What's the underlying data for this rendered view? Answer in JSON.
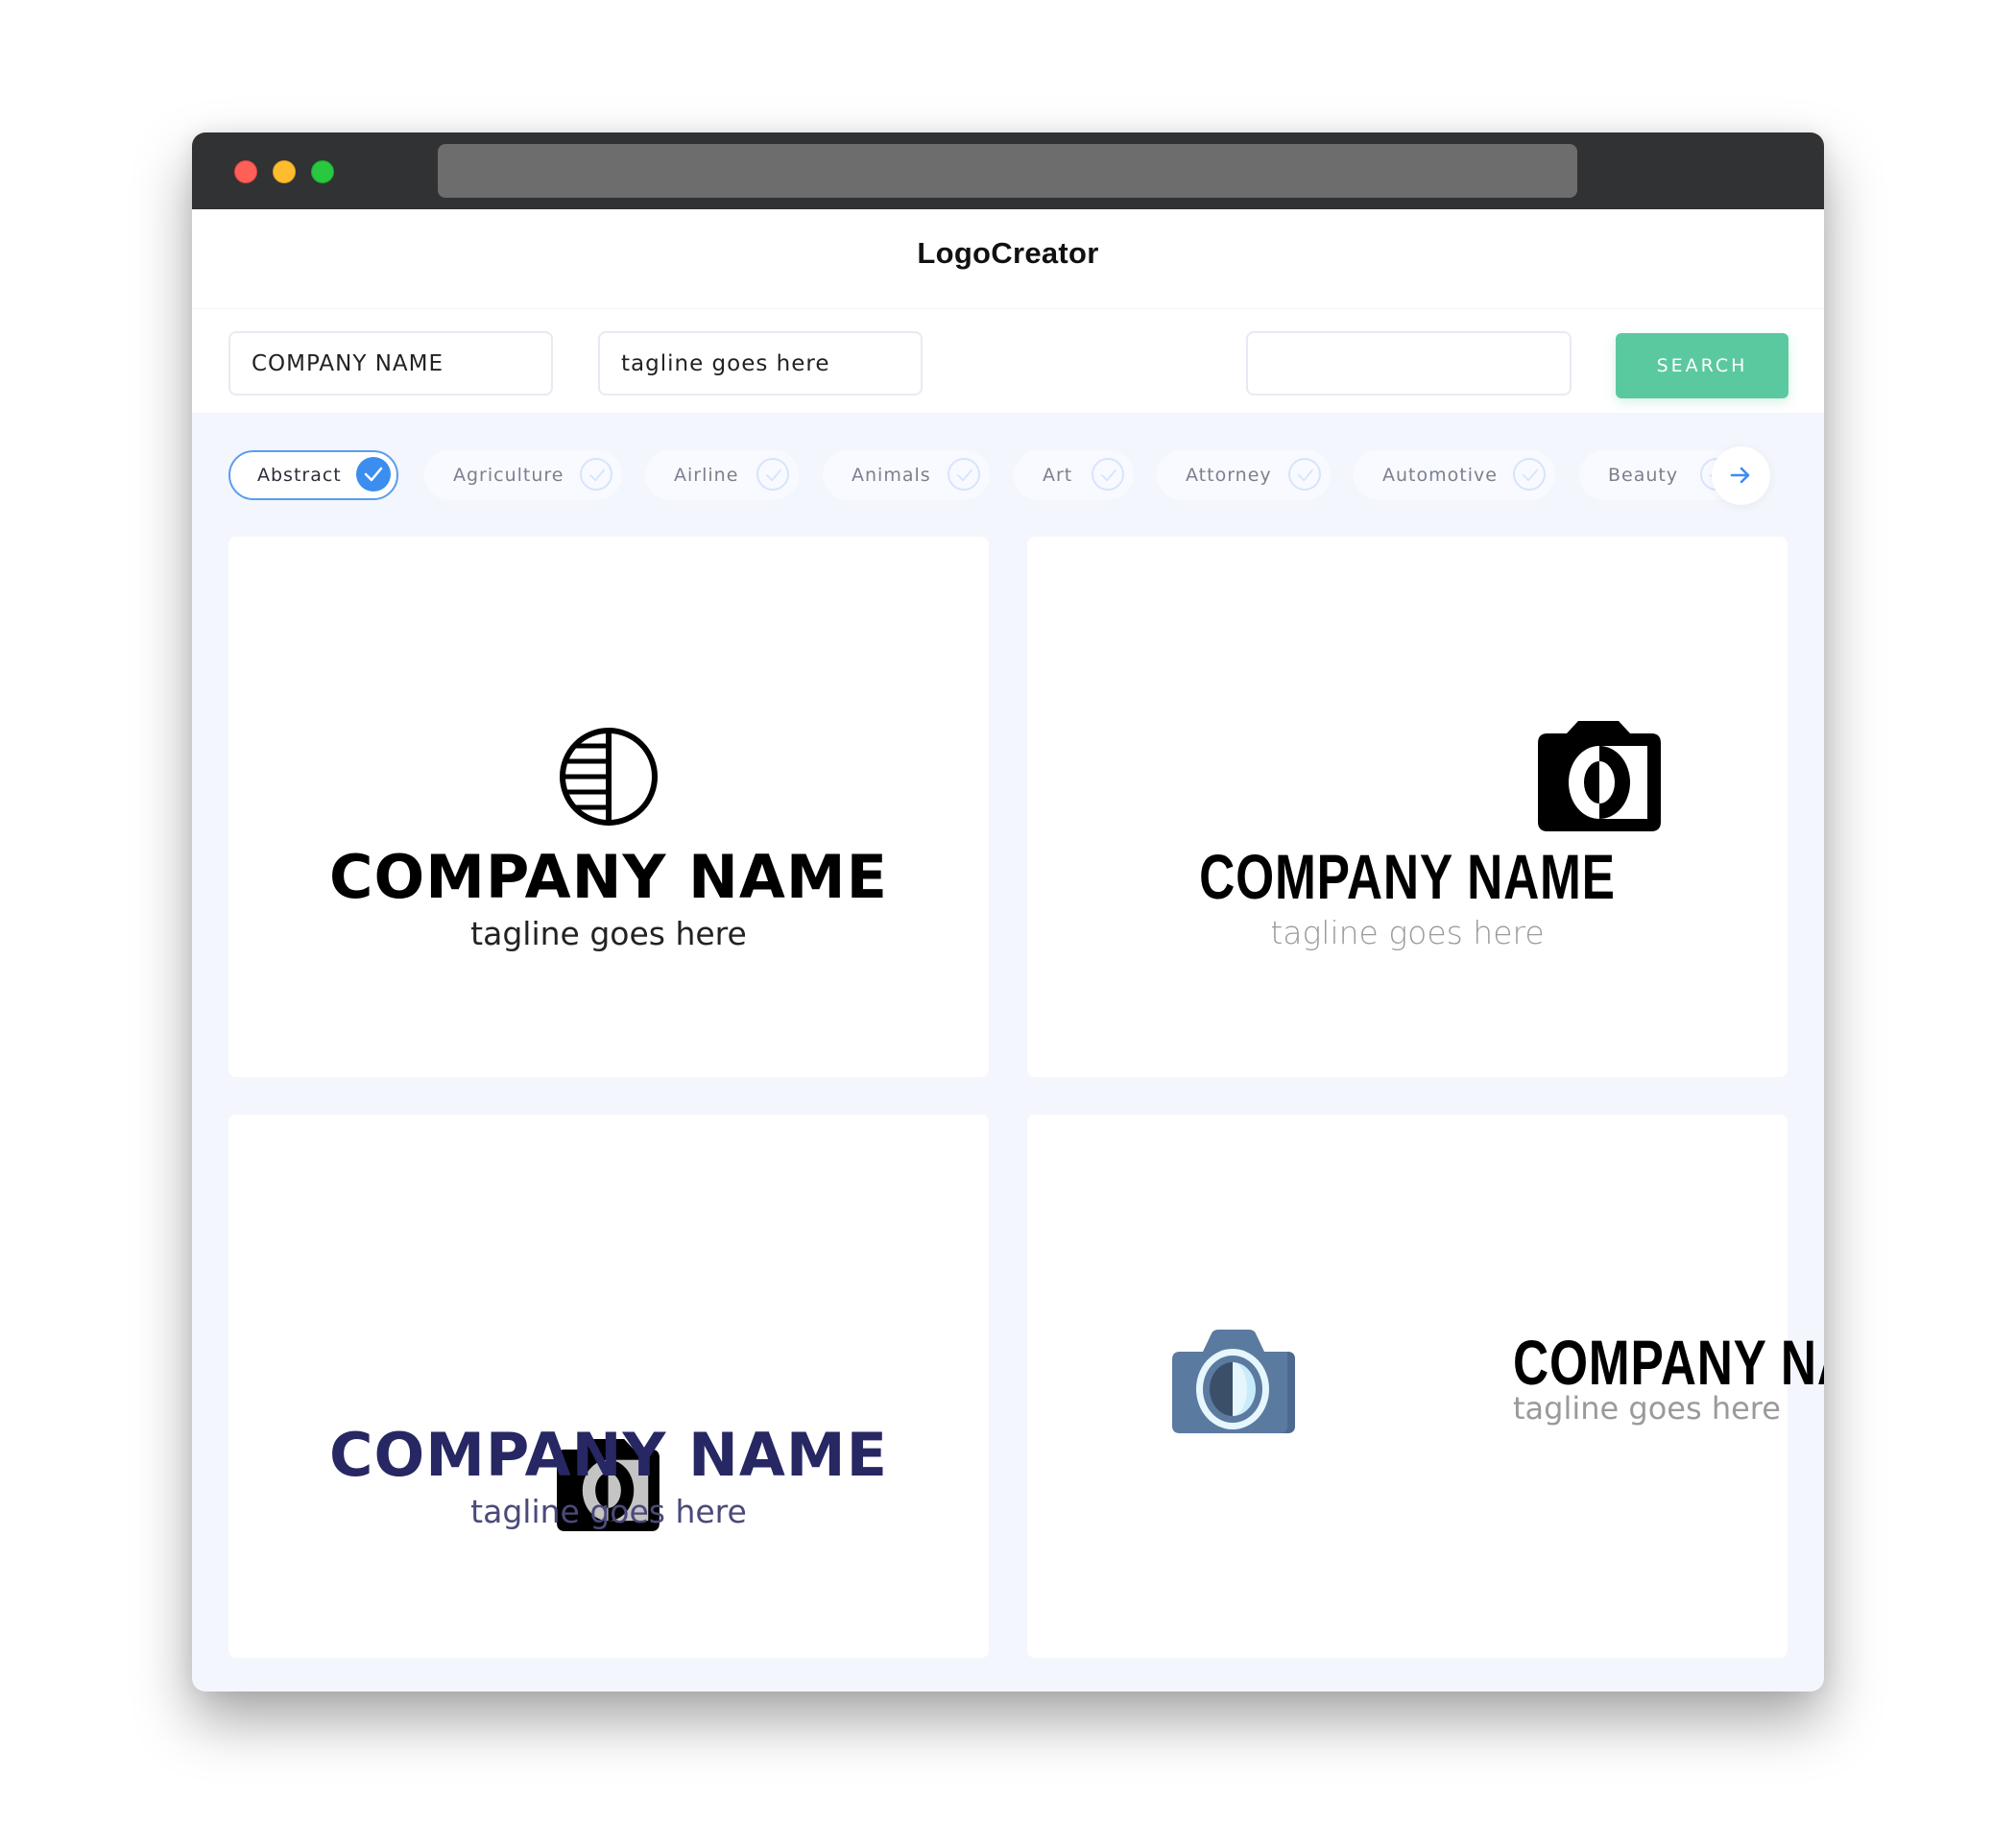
{
  "window": {
    "controls": [
      "close",
      "minimize",
      "maximize"
    ]
  },
  "header": {
    "brand": "LogoCreator"
  },
  "form": {
    "company_name_value": "COMPANY NAME",
    "tagline_value": "tagline goes here",
    "keyword_value": "",
    "search_label": "SEARCH"
  },
  "categories": {
    "items": [
      {
        "label": "Abstract",
        "selected": true
      },
      {
        "label": "Agriculture",
        "selected": false
      },
      {
        "label": "Airline",
        "selected": false
      },
      {
        "label": "Animals",
        "selected": false
      },
      {
        "label": "Art",
        "selected": false
      },
      {
        "label": "Attorney",
        "selected": false
      },
      {
        "label": "Automotive",
        "selected": false
      },
      {
        "label": "Beauty",
        "selected": false
      }
    ],
    "next_icon": "arrow-right-icon"
  },
  "logos": [
    {
      "company": "COMPANY NAME",
      "tagline": "tagline goes here",
      "icon": "half-striped-circle-icon",
      "name_color": "#000000",
      "tagline_color": "#222222"
    },
    {
      "company": "COMPANY NAME",
      "tagline": "tagline goes here",
      "icon": "camera-icon",
      "name_color": "#000000",
      "tagline_color": "#9a9a9a"
    },
    {
      "company": "COMPANY NAME",
      "tagline": "tagline goes here",
      "icon": "camera-icon",
      "name_color": "#272763",
      "tagline_color": "#4a4a7a"
    },
    {
      "company": "COMPANY NAME",
      "tagline": "tagline goes here",
      "icon": "camera-icon",
      "name_color": "#000000",
      "tagline_color": "#9a9a9a"
    }
  ],
  "colors": {
    "accent": "#3b8ef0",
    "search_button": "#5bc9a0",
    "titlebar": "#313234",
    "content_bg": "#f3f6fc"
  }
}
